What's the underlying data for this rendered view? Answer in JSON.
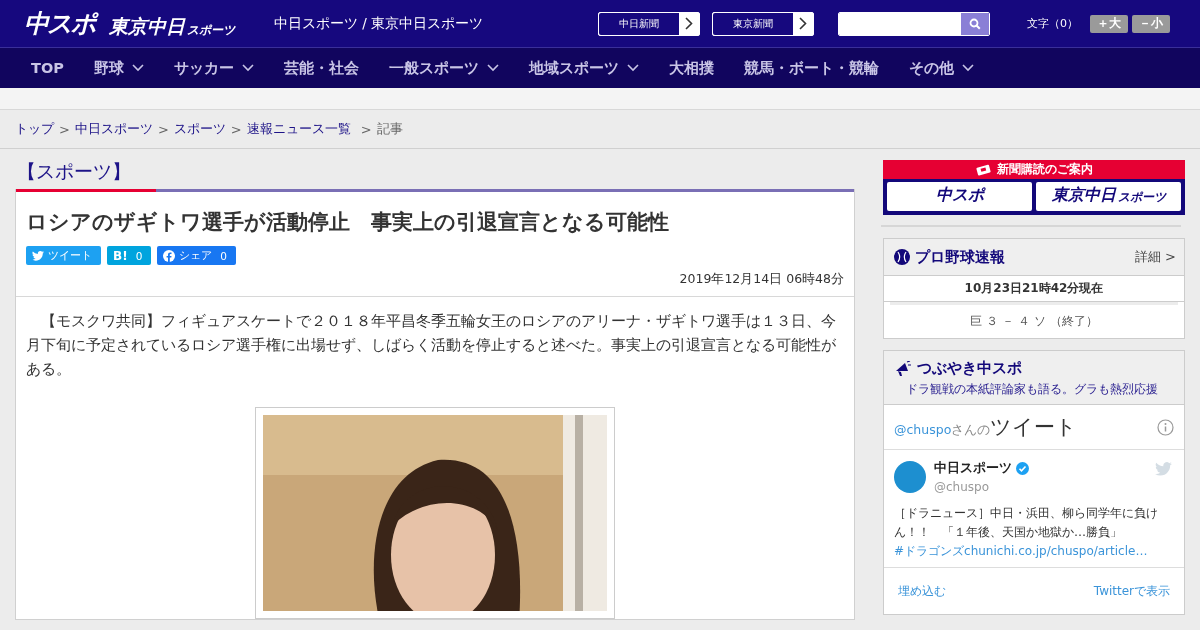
{
  "header": {
    "logo": {
      "main": "中スポ",
      "sub": "東京中日",
      "sub_small": "スポーツ"
    },
    "site_name": "中日スポーツ / 東京中日スポーツ",
    "links": [
      "中日新聞",
      "東京新聞"
    ],
    "font_size": {
      "label": "文字（0）",
      "buttons": [
        "＋大",
        "－小"
      ]
    }
  },
  "nav": [
    {
      "label": "TOP",
      "dropdown": false
    },
    {
      "label": "野球",
      "dropdown": true
    },
    {
      "label": "サッカー",
      "dropdown": true
    },
    {
      "label": "芸能・社会",
      "dropdown": false
    },
    {
      "label": "一般スポーツ",
      "dropdown": true
    },
    {
      "label": "地域スポーツ",
      "dropdown": true
    },
    {
      "label": "大相撲",
      "dropdown": false
    },
    {
      "label": "競馬・ボート・競輪",
      "dropdown": false
    },
    {
      "label": "その他",
      "dropdown": true
    }
  ],
  "breadcrumb": {
    "separator": ">",
    "items": [
      {
        "label": "トップ",
        "link": true
      },
      {
        "label": "中日スポーツ",
        "link": true
      },
      {
        "label": "スポーツ",
        "link": true
      },
      {
        "label": "速報ニュース一覧",
        "link": true
      },
      {
        "label": "記事",
        "link": false
      }
    ]
  },
  "category": "【スポーツ】",
  "article": {
    "title": "ロシアのザギトワ選手が活動停止　事実上の引退宣言となる可能性",
    "share": [
      {
        "kind": "tweet",
        "label": "ツイート"
      },
      {
        "kind": "hatena",
        "label": "B!",
        "count": "0"
      },
      {
        "kind": "facebook",
        "label": "シェア",
        "count": "0"
      }
    ],
    "date": "2019年12月14日 06時48分",
    "body": "【モスクワ共同】フィギュアスケートで２０１８年平昌冬季五輪女王のロシアのアリーナ・ザギトワ選手は１３日、今月下旬に予定されているロシア選手権に出場せず、しばらく活動を停止すると述べた。事実上の引退宣言となる可能性がある。"
  },
  "sidebar": {
    "subscribe": {
      "title": "新聞購読のご案内",
      "logos": [
        {
          "main": "中スポ"
        },
        {
          "main": "東京中日",
          "small": "スポーツ"
        }
      ]
    },
    "baseball": {
      "title": "プロ野球速報",
      "more": "詳細 >",
      "time": "10月23日21時42分現在",
      "score": "巨 ３ － ４ ソ （終了）"
    },
    "tweets": {
      "title": "つぶやき中スポ",
      "subtitle": "ドラ観戦の本紙評論家も語る。グラも熱烈応援",
      "handle": "@chuspo",
      "handle_suffix": "さんの",
      "heading": "ツイート",
      "tweet": {
        "name": "中日スポーツ",
        "verified": true,
        "user": "@chuspo",
        "text": "［ドラニュース］中日・浜田、柳ら同学年に負けん！！　「１年後、天国か地獄か…勝負」",
        "hashtag": "#ドラゴンズ",
        "link": "chunichi.co.jp/chuspo/article…"
      },
      "footer": [
        "埋め込む",
        "Twitterで表示"
      ]
    }
  }
}
